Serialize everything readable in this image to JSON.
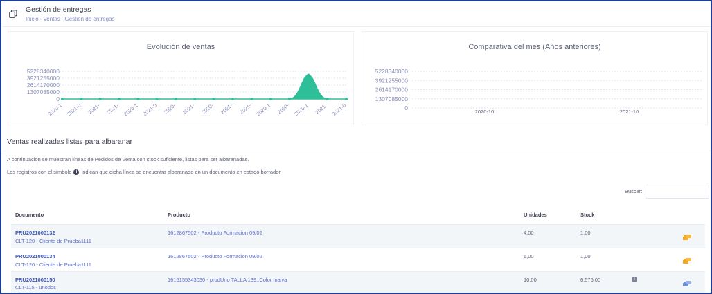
{
  "header": {
    "title": "Gestión de entregas",
    "icon": "copy-icon",
    "breadcrumb": [
      "Inicio",
      "Ventas",
      "Gestión de entregas"
    ]
  },
  "charts": {
    "ventas_title": "Evolución de ventas",
    "comparativa_title": "Comparativa del mes (Años anteriores)"
  },
  "chart_data": [
    {
      "type": "area",
      "title": "Evolución de ventas",
      "y_ticks": [
        "5228340000",
        "3921255000",
        "2614170000",
        "1307085000",
        "0"
      ],
      "ylim": [
        0,
        5228340000
      ],
      "x_tick_labels": [
        "2020-1",
        "2021-0",
        "2021-",
        "2021-",
        "2020-1",
        "2021-0",
        "2020-",
        "2021-",
        "2020-",
        "2021-",
        "2021-",
        "2020-1",
        "2020-",
        "2020-1",
        "2021-",
        "2021-0"
      ],
      "values": [
        0,
        0,
        0,
        0,
        0,
        0,
        0,
        0,
        0,
        0,
        0,
        0,
        0,
        4500000000,
        0,
        0
      ],
      "color": "#2fbf98",
      "grid": true,
      "legend": "none"
    },
    {
      "type": "bar",
      "title": "Comparativa del mes (Años anteriores)",
      "y_ticks": [
        "5228340000",
        "3921255000",
        "2614170000",
        "1307085000",
        "0"
      ],
      "ylim": [
        0,
        5228340000
      ],
      "categories": [
        "2020-10",
        "2021-10"
      ],
      "values": [
        0,
        0
      ],
      "grid": true
    }
  ],
  "section": {
    "title": "Ventas realizadas listas para albaranar",
    "info_1": "A continuación se muestran líneas de Pedidos de Venta con stock suficiente, listas para ser albaranadas.",
    "info_2_before": "Los registros con el símbolo",
    "info_2_icon": "i",
    "info_2_after": "indican que dicha línea se encuentra albaranado en un documento en estado borrador."
  },
  "search": {
    "label": "Buscar:",
    "value": ""
  },
  "table": {
    "headers": {
      "documento": "Documento",
      "producto": "Producto",
      "unidades": "Unidades",
      "stock": "Stock"
    },
    "rows": [
      {
        "documento": "PRU2021000132",
        "cliente": "CLT-120 - Cliente de Prueba1111",
        "producto": "1612867502 - Producto Formacion 09/02",
        "unidades": "4,00",
        "stock": "1,00",
        "draft": false,
        "action_color": "#f5a623"
      },
      {
        "documento": "PRU2021000134",
        "cliente": "CLT-120 - Cliente de Prueba1111",
        "producto": "1612867502 - Producto Formacion 09/02",
        "unidades": "6,00",
        "stock": "1,00",
        "draft": false,
        "action_color": "#f5a623"
      },
      {
        "documento": "PRU2021000150",
        "cliente": "CLT-115 - unodos",
        "producto": "1616155343030 - prodUno TALLA 139;;Color malva",
        "unidades": "10,00",
        "stock": "6.576,00",
        "draft": true,
        "draft_icon": "i",
        "action_color": "#6f8fd8"
      }
    ]
  }
}
